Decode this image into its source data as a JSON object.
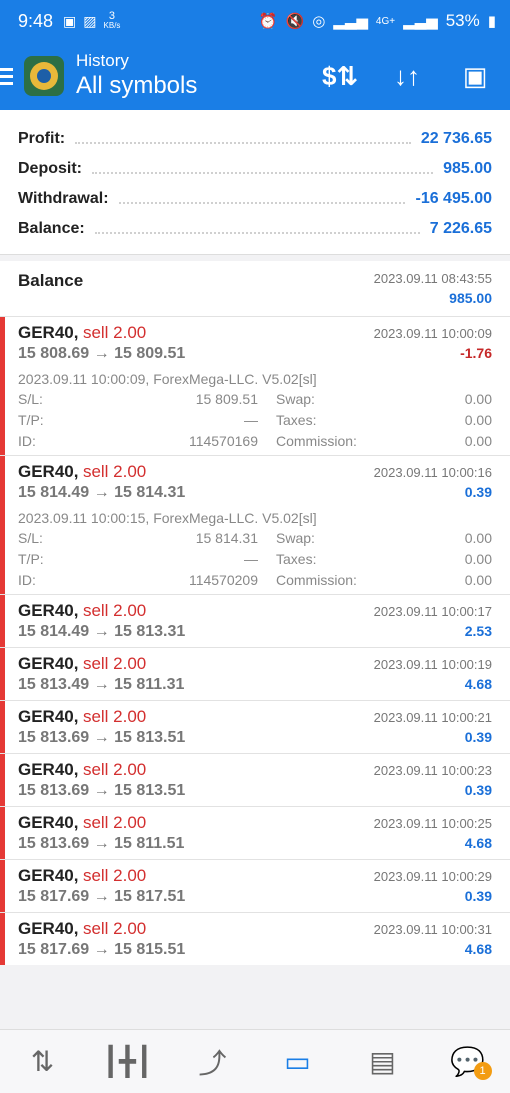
{
  "status_bar": {
    "time": "9:48",
    "speed": "3",
    "speed_unit": "KB/s",
    "network": "4G+",
    "battery": "53%"
  },
  "header": {
    "subtitle": "History",
    "title": "All symbols",
    "icons": [
      "dollar-exchange-icon",
      "sort-icon",
      "calendar-icon"
    ]
  },
  "summary": {
    "rows": [
      {
        "label": "Profit:",
        "value": "22 736.65"
      },
      {
        "label": "Deposit:",
        "value": "985.00"
      },
      {
        "label": "Withdrawal:",
        "value": "-16 495.00"
      },
      {
        "label": "Balance:",
        "value": "7 226.65"
      }
    ]
  },
  "balance_entry": {
    "label": "Balance",
    "time": "2023.09.11 08:43:55",
    "amount": "985.00"
  },
  "detail_labels": {
    "sl": "S/L:",
    "tp": "T/P:",
    "id": "ID:",
    "swap": "Swap:",
    "taxes": "Taxes:",
    "commission": "Commission:"
  },
  "deals": [
    {
      "symbol": "GER40,",
      "side": "sell 2.00",
      "time": "2023.09.11 10:00:09",
      "prices": "15 808.69 → 15 809.51",
      "profit": "-1.76",
      "negative": true,
      "expanded": true,
      "comment": "2023.09.11 10:00:09, ForexMega-LLC. V5.02[sl]",
      "sl": "15 809.51",
      "tp": "—",
      "id": "114570169",
      "swap": "0.00",
      "taxes": "0.00",
      "commission": "0.00"
    },
    {
      "symbol": "GER40,",
      "side": "sell 2.00",
      "time": "2023.09.11 10:00:16",
      "prices": "15 814.49 → 15 814.31",
      "profit": "0.39",
      "negative": false,
      "expanded": true,
      "comment": "2023.09.11 10:00:15, ForexMega-LLC. V5.02[sl]",
      "sl": "15 814.31",
      "tp": "—",
      "id": "114570209",
      "swap": "0.00",
      "taxes": "0.00",
      "commission": "0.00"
    },
    {
      "symbol": "GER40,",
      "side": "sell 2.00",
      "time": "2023.09.11 10:00:17",
      "prices": "15 814.49 → 15 813.31",
      "profit": "2.53",
      "negative": false,
      "expanded": false
    },
    {
      "symbol": "GER40,",
      "side": "sell 2.00",
      "time": "2023.09.11 10:00:19",
      "prices": "15 813.49 → 15 811.31",
      "profit": "4.68",
      "negative": false,
      "expanded": false
    },
    {
      "symbol": "GER40,",
      "side": "sell 2.00",
      "time": "2023.09.11 10:00:21",
      "prices": "15 813.69 → 15 813.51",
      "profit": "0.39",
      "negative": false,
      "expanded": false
    },
    {
      "symbol": "GER40,",
      "side": "sell 2.00",
      "time": "2023.09.11 10:00:23",
      "prices": "15 813.69 → 15 813.51",
      "profit": "0.39",
      "negative": false,
      "expanded": false
    },
    {
      "symbol": "GER40,",
      "side": "sell 2.00",
      "time": "2023.09.11 10:00:25",
      "prices": "15 813.69 → 15 811.51",
      "profit": "4.68",
      "negative": false,
      "expanded": false
    },
    {
      "symbol": "GER40,",
      "side": "sell 2.00",
      "time": "2023.09.11 10:00:29",
      "prices": "15 817.69 → 15 817.51",
      "profit": "0.39",
      "negative": false,
      "expanded": false
    },
    {
      "symbol": "GER40,",
      "side": "sell 2.00",
      "time": "2023.09.11 10:00:31",
      "prices": "15 817.69 → 15 815.51",
      "profit": "4.68",
      "negative": false,
      "expanded": false
    }
  ],
  "bottom_nav": {
    "items": [
      "quotes-icon",
      "chart-icon",
      "trade-icon",
      "history-icon",
      "news-icon",
      "messages-icon"
    ],
    "active": "history-icon",
    "badge": "1"
  },
  "colors": {
    "accent": "#1a7ee6",
    "sell": "#d32f2f",
    "profit": "#1a6fd8",
    "loss": "#c62828"
  }
}
